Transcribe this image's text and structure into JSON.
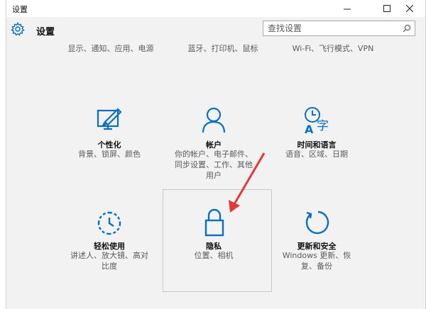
{
  "window": {
    "title": "设置"
  },
  "header": {
    "title": "设置",
    "search_placeholder": "查找设置"
  },
  "top_row": [
    {
      "desc": "显示、通知、应用、电源"
    },
    {
      "desc": "蓝牙、打印机、鼠标"
    },
    {
      "desc": "Wi-Fi、飞行模式、VPN"
    }
  ],
  "tiles": [
    {
      "name": "个性化",
      "desc": "背景、锁屏、颜色",
      "icon": "personalization-icon"
    },
    {
      "name": "帐户",
      "desc": "你的帐户、电子邮件、同步设置、工作、其他用户",
      "icon": "account-icon"
    },
    {
      "name": "时间和语言",
      "desc": "语音、区域、日期",
      "icon": "time-language-icon"
    },
    {
      "name": "轻松使用",
      "desc": "讲述人、放大镜、高对比度",
      "icon": "ease-of-access-icon"
    },
    {
      "name": "隐私",
      "desc": "位置、相机",
      "icon": "lock-icon"
    },
    {
      "name": "更新和安全",
      "desc": "Windows 更新、恢复、备份",
      "icon": "update-icon"
    }
  ],
  "colors": {
    "accent": "#0a6fc2",
    "arrow": "#e23a3a"
  }
}
